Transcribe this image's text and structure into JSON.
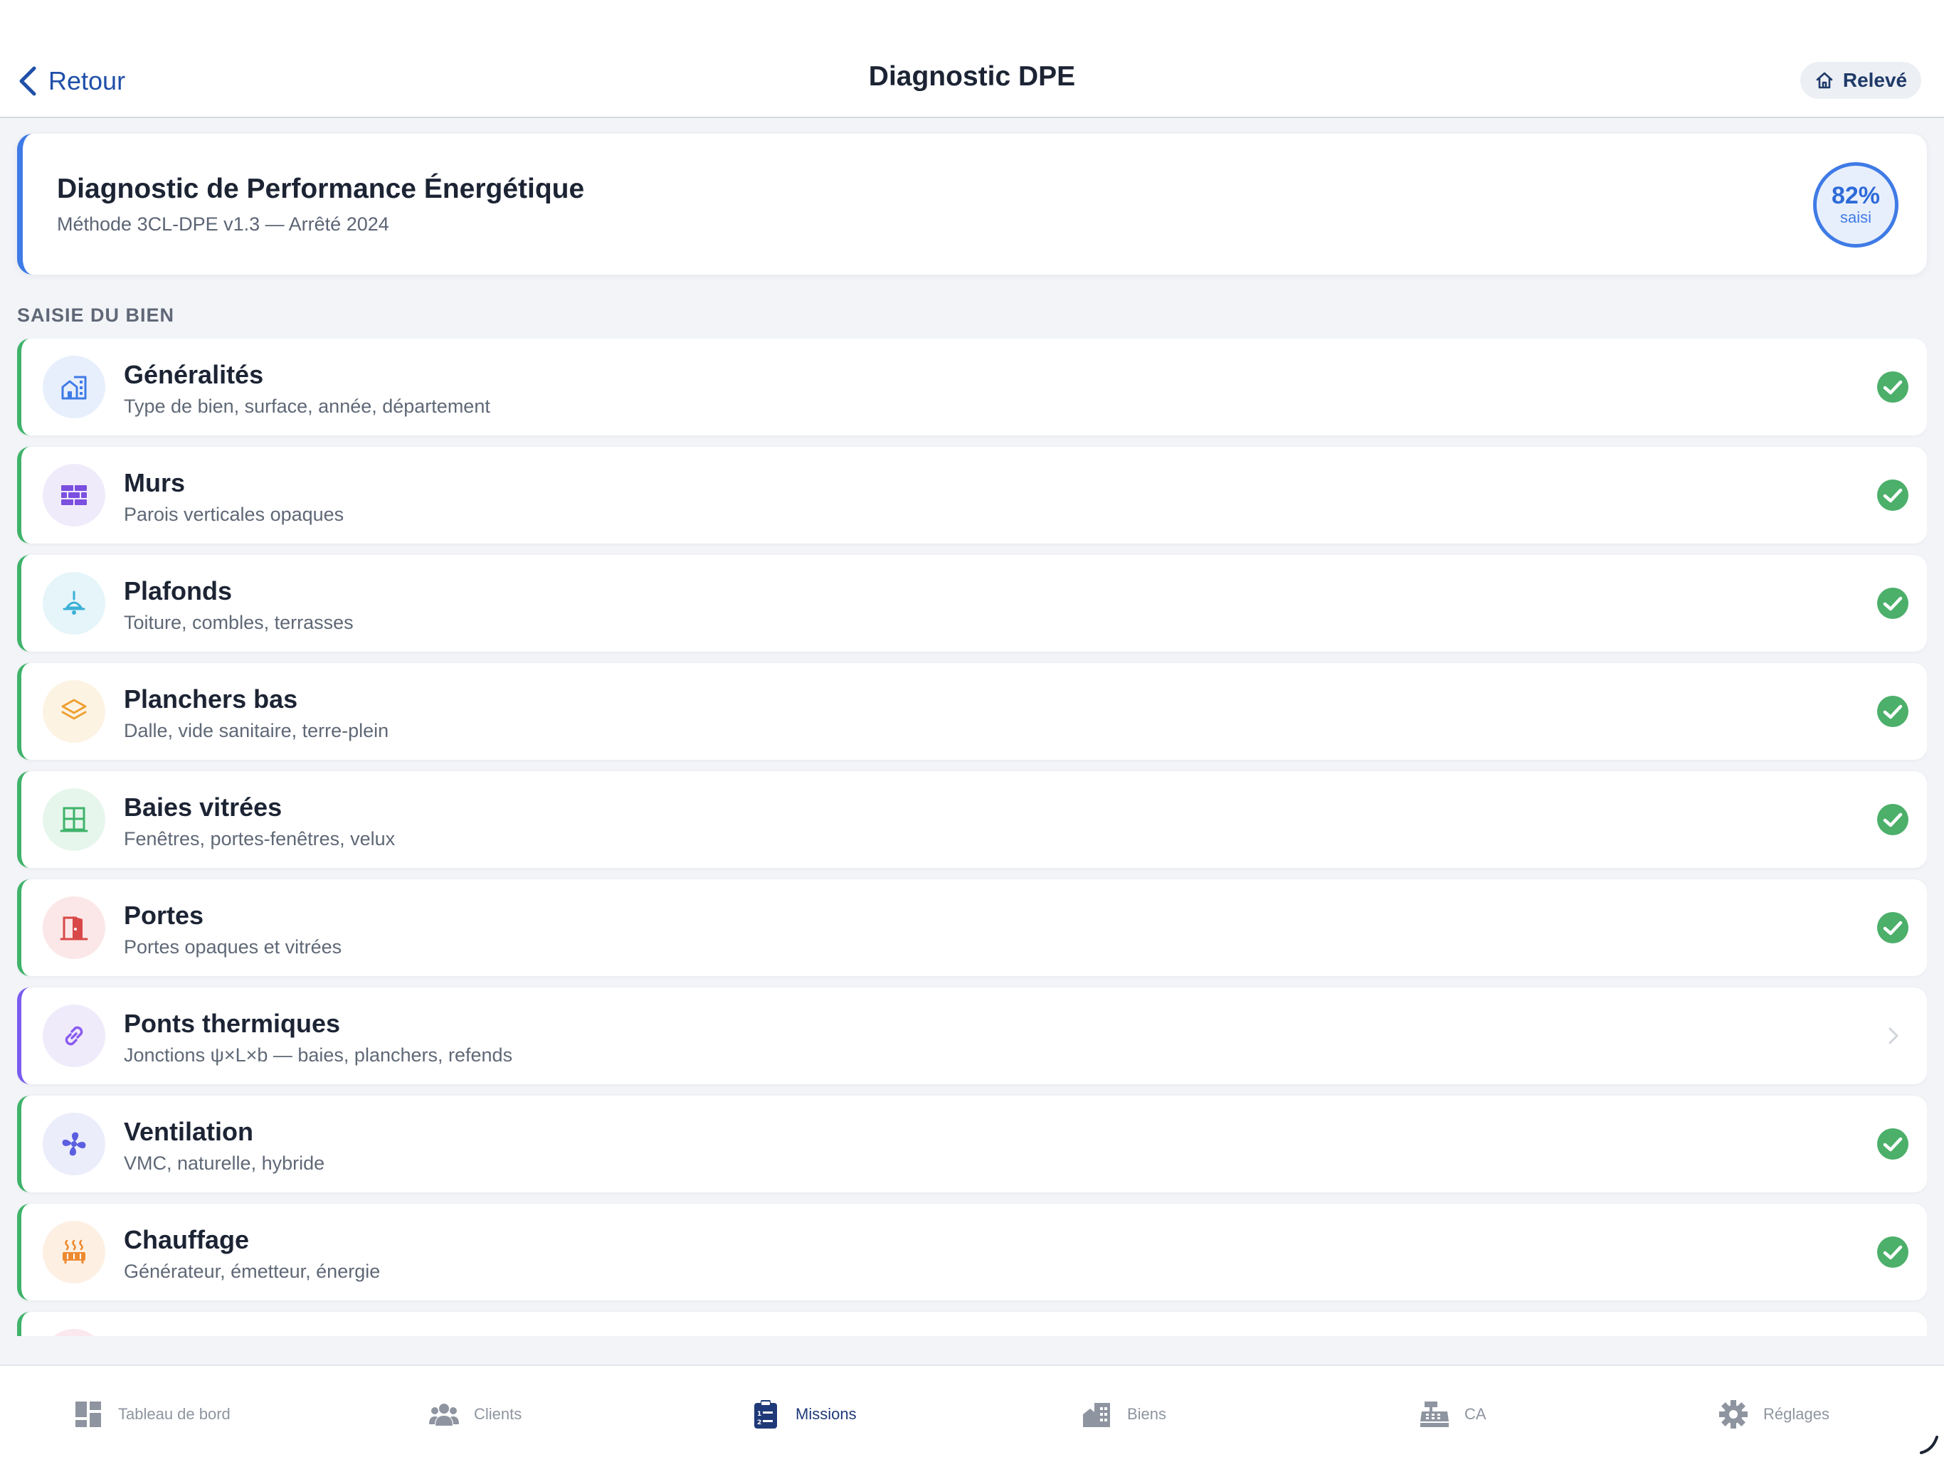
{
  "header": {
    "back_label": "Retour",
    "title": "Diagnostic DPE",
    "releve_label": "Relevé"
  },
  "hero": {
    "title": "Diagnostic de Performance Énergétique",
    "subtitle": "Méthode 3CL-DPE v1.3 — Arrêté 2024",
    "progress_value": "82%",
    "progress_label": "saisi"
  },
  "section_label": "SAISIE DU BIEN",
  "sections": [
    {
      "title": "Généralités",
      "subtitle": "Type de bien, surface, année, département",
      "icon": "building-icon",
      "color": "#3f7be6",
      "bg": "#e7effc",
      "status": "complete"
    },
    {
      "title": "Murs",
      "subtitle": "Parois verticales opaques",
      "icon": "brick-wall-icon",
      "color": "#7b4fe0",
      "bg": "#f0ebfb",
      "status": "complete"
    },
    {
      "title": "Plafonds",
      "subtitle": "Toiture, combles, terrasses",
      "icon": "ceiling-lamp-icon",
      "color": "#3bb0d6",
      "bg": "#e5f5fa",
      "status": "complete"
    },
    {
      "title": "Planchers bas",
      "subtitle": "Dalle, vide sanitaire, terre-plein",
      "icon": "layers-icon",
      "color": "#eea030",
      "bg": "#fdf3e3",
      "status": "complete"
    },
    {
      "title": "Baies vitrées",
      "subtitle": "Fenêtres, portes-fenêtres, velux",
      "icon": "window-icon",
      "color": "#3fb36a",
      "bg": "#e6f6ec",
      "status": "complete"
    },
    {
      "title": "Portes",
      "subtitle": "Portes opaques et vitrées",
      "icon": "door-icon",
      "color": "#d94848",
      "bg": "#fbe7e7",
      "status": "complete"
    },
    {
      "title": "Ponts thermiques",
      "subtitle": "Jonctions ψ×L×b — baies, planchers, refends",
      "icon": "link-icon",
      "color": "#8a5cf0",
      "bg": "#f0ebfb",
      "status": "pending"
    },
    {
      "title": "Ventilation",
      "subtitle": "VMC, naturelle, hybride",
      "icon": "fan-icon",
      "color": "#5a5ee0",
      "bg": "#ecedfb",
      "status": "complete"
    },
    {
      "title": "Chauffage",
      "subtitle": "Générateur, émetteur, énergie",
      "icon": "heater-icon",
      "color": "#ee8a30",
      "bg": "#fdf0e3",
      "status": "complete"
    }
  ],
  "colors": {
    "accent": "#3f7be6",
    "complete": "#3fb36a",
    "check": "#4caf6a"
  },
  "tabs": [
    {
      "label": "Tableau de bord",
      "icon": "dashboard-icon",
      "active": false
    },
    {
      "label": "Clients",
      "icon": "users-icon",
      "active": false
    },
    {
      "label": "Missions",
      "icon": "clipboard-icon",
      "active": true
    },
    {
      "label": "Biens",
      "icon": "buildings-icon",
      "active": false
    },
    {
      "label": "CA",
      "icon": "cash-register-icon",
      "active": false
    },
    {
      "label": "Réglages",
      "icon": "gear-icon",
      "active": false
    }
  ]
}
